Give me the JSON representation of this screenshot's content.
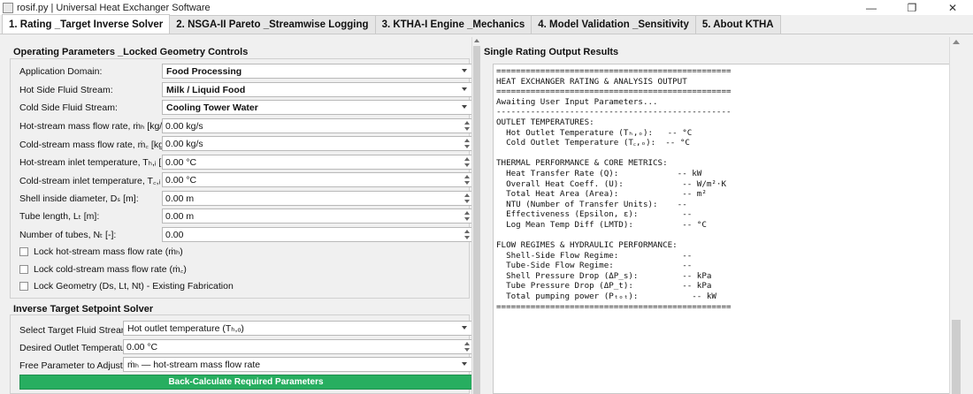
{
  "window": {
    "title": "rosif.py | Universal Heat Exchanger Software",
    "controls": [
      "—",
      "❐",
      "✕"
    ]
  },
  "tabs": [
    {
      "label": "1. Rating _Target Inverse Solver",
      "active": true
    },
    {
      "label": "2. NSGA-II Pareto _Streamwise Logging",
      "active": false
    },
    {
      "label": "3. KTHA-I Engine _Mechanics",
      "active": false
    },
    {
      "label": "4. Model Validation _Sensitivity",
      "active": false
    },
    {
      "label": "5. About KTHA",
      "active": false
    }
  ],
  "operating": {
    "title": "Operating Parameters _Locked Geometry Controls",
    "application_domain": {
      "label": "Application Domain:",
      "value": "Food Processing"
    },
    "hot_fluid": {
      "label": "Hot Side Fluid Stream:",
      "value": "Milk / Liquid Food"
    },
    "cold_fluid": {
      "label": "Cold Side Fluid Stream:",
      "value": "Cooling Tower Water"
    },
    "hot_mass_flow": {
      "label": "Hot-stream mass flow rate, ṁₕ [kg/s]:",
      "value": "0.00 kg/s"
    },
    "cold_mass_flow": {
      "label": "Cold-stream mass flow rate, ṁ꜀ [kg/s]:",
      "value": "0.00 kg/s"
    },
    "hot_inlet_temp": {
      "label": "Hot-stream inlet temperature, Tₕ,ᵢ [°C]:",
      "value": "0.00 °C"
    },
    "cold_inlet_temp": {
      "label": "Cold-stream inlet temperature, T꜀,ᵢ [°C]:",
      "value": "0.00 °C"
    },
    "shell_diameter": {
      "label": "Shell inside diameter, Dₛ [m]:",
      "value": "0.00 m"
    },
    "tube_length": {
      "label": "Tube length, Lₜ [m]:",
      "value": "0.00 m"
    },
    "num_tubes": {
      "label": "Number of tubes, Nₜ [-]:",
      "value": "0.00"
    },
    "lock_hot": "Lock hot-stream mass flow rate (ṁₕ)",
    "lock_cold": "Lock cold-stream mass flow rate (ṁ꜀)",
    "lock_geometry": "Lock Geometry (Ds, Lt, Nt) - Existing Fabrication"
  },
  "inverse": {
    "title": "Inverse Target Setpoint Solver",
    "target_fluid": {
      "label": "Select Target Fluid Stream:",
      "value": "Hot outlet temperature (Tₕ,ₒ)"
    },
    "desired_temp": {
      "label": "Desired Outlet Temperature:",
      "value": "0.00 °C"
    },
    "free_param": {
      "label": "Free Parameter to Adjust:",
      "value": "ṁₕ — hot-stream mass flow rate"
    },
    "button": "Back-Calculate Required Parameters"
  },
  "output": {
    "title": "Single Rating Output Results",
    "text": "================================================\nHEAT EXCHANGER RATING & ANALYSIS OUTPUT\n================================================\nAwaiting User Input Parameters...\n------------------------------------------------\nOUTLET TEMPERATURES:\n  Hot Outlet Temperature (Tₕ,ₒ):   -- °C\n  Cold Outlet Temperature (T꜀,ₒ):  -- °C\n\nTHERMAL PERFORMANCE & CORE METRICS:\n  Heat Transfer Rate (Q):            -- kW\n  Overall Heat Coeff. (U):            -- W/m²·K\n  Total Heat Area (Area):             -- m²\n  NTU (Number of Transfer Units):    --\n  Effectiveness (Epsilon, ε):         --\n  Log Mean Temp Diff (LMTD):          -- °C\n\nFLOW REGIMES & HYDRAULIC PERFORMANCE:\n  Shell-Side Flow Regime:             --\n  Tube-Side Flow Regime:              --\n  Shell Pressure Drop (ΔP_s):         -- kPa\n  Tube Pressure Drop (ΔP_t):          -- kPa\n  Total pumping power (Pₜₒₜ):           -- kW\n================================================"
  },
  "colors": {
    "accent_green": "#27ae60"
  }
}
